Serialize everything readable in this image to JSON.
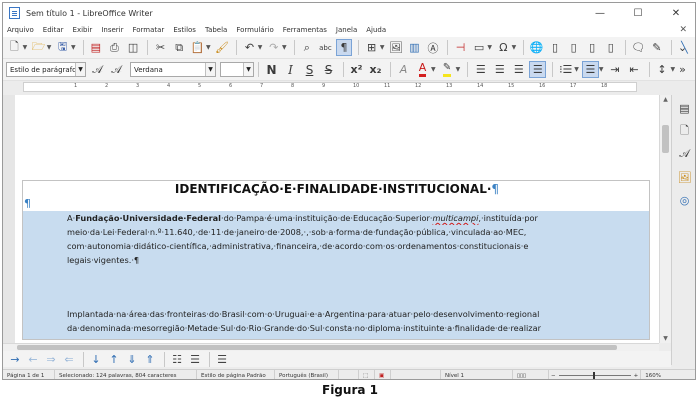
{
  "window": {
    "title": "Sem título 1 - LibreOffice Writer",
    "controls": {
      "minimize": "—",
      "maximize": "☐",
      "close": "✕"
    }
  },
  "menu": {
    "items": [
      "Arquivo",
      "Editar",
      "Exibir",
      "Inserir",
      "Formatar",
      "Estilos",
      "Tabela",
      "Formulário",
      "Ferramentas",
      "Janela",
      "Ajuda"
    ],
    "close_doc": "✕"
  },
  "toolbar_standard": {
    "icons": [
      "new-document",
      "open",
      "save",
      "export-pdf",
      "print",
      "print-preview",
      "cut",
      "copy",
      "paste",
      "clone-formatting",
      "undo",
      "redo",
      "find-replace",
      "spelling",
      "formatting-marks",
      "insert-table",
      "insert-image",
      "insert-chart",
      "insert-text-box",
      "page-break",
      "insert-field",
      "special-character",
      "hyperlink",
      "footnote",
      "endnote",
      "bookmark",
      "cross-reference",
      "comment",
      "track-changes",
      "line",
      "show-draw-functions"
    ]
  },
  "toolbar_formatting": {
    "paragraph_style": "Estilo de parágrafo Padrão",
    "font_name": "Verdana",
    "font_size": "",
    "buttons": {
      "bold": "N",
      "italic": "I",
      "underline": "S",
      "strikethrough": "S",
      "superscript": "x²",
      "subscript": "x₂",
      "font_color": "A",
      "highlight": "✎"
    },
    "colors": {
      "font_color": "#d42020",
      "highlight": "#f5e51c"
    }
  },
  "ruler": {
    "numbers": [
      "1",
      "2",
      "3",
      "4",
      "5",
      "6",
      "7",
      "8",
      "9",
      "10",
      "11",
      "12",
      "13",
      "14",
      "15",
      "16",
      "17",
      "18"
    ]
  },
  "document": {
    "title": "IDENTIFICAÇÃO·E·FINALIDADE·INSTITUCIONAL·",
    "pilcrow": "¶",
    "para1": {
      "lead": "A·",
      "org": "Fundação·Universidade·Federal",
      "line1_rest": "·do·Pampa·é·uma·instituição·de·Educação·Superior·",
      "multicampi": "multicampi",
      "line1_tail": ",·instituída·por",
      "line2": "meio·da·Lei·Federal·n.º·11.640,·de·11·de·janeiro·de·2008,·,·sob·a·forma·de·fundação·pública,·vinculada·ao·MEC,",
      "line3": "com·autonomia·didático-científica,·administrativa,·financeira,·de·acordo·com·os·ordenamentos·constitucionais·e",
      "line4": "legais·vigentes.·¶"
    },
    "para2": {
      "line1": "Implantada·na·área·das·fronteiras·do·Brasil·com·o·Uruguai·e·a·Argentina·para·atuar·pelo·desenvolvimento·regional",
      "line2": "da·denominada·mesorregião·Metade·Sul·do·Rio·Grande·do·Sul·consta·no·diploma·instituinte·a·finalidade·de·realizar"
    },
    "selection_color": "#c8dcef"
  },
  "statusbar": {
    "page": "Página 1 de 1",
    "selection": "Selecionado: 124 palavras, 804 caracteres",
    "page_style": "Estilo de página Padrão",
    "language": "Português (Brasil)",
    "level": "Nível 1",
    "zoom": "160%"
  },
  "caption": "Figura 1"
}
